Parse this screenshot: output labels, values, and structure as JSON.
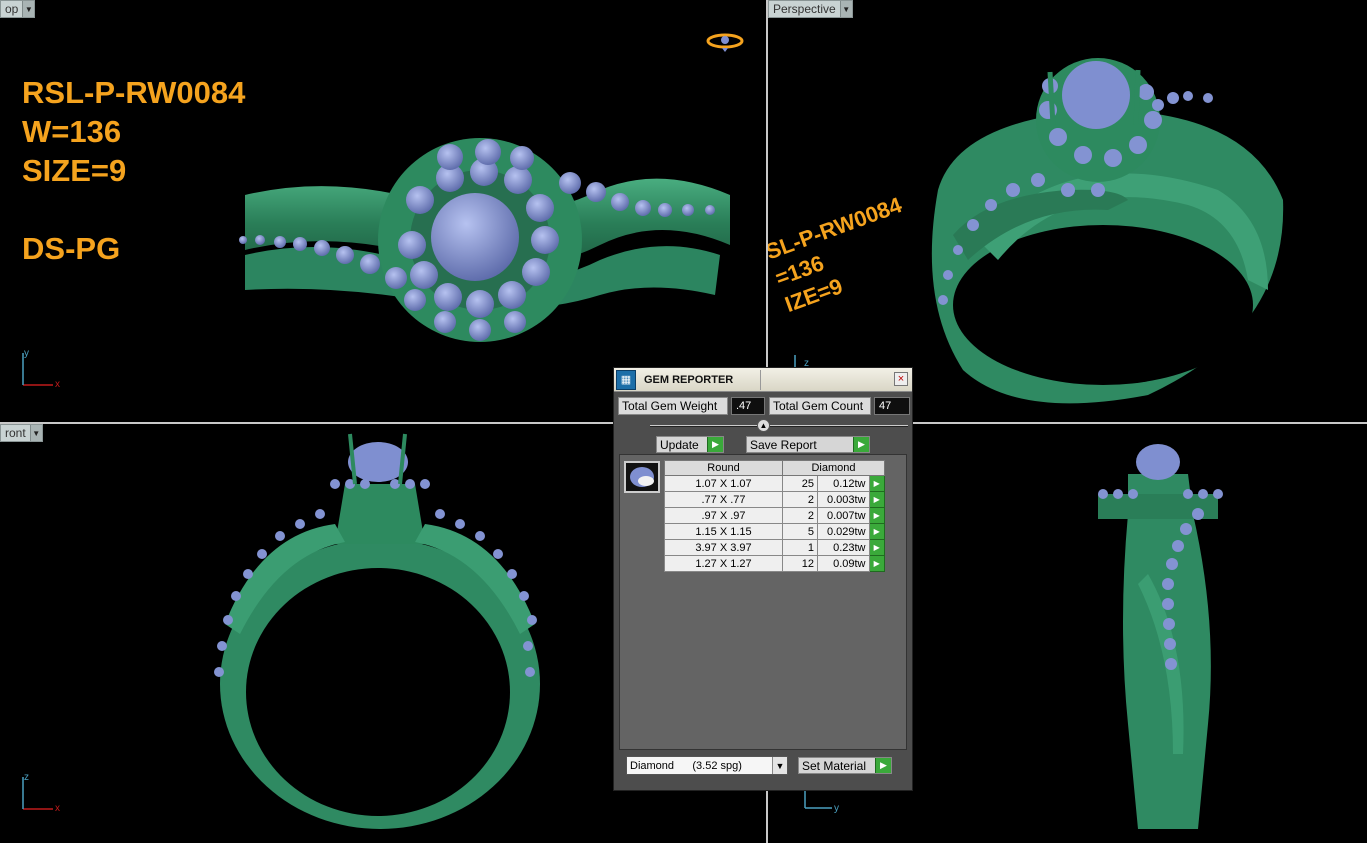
{
  "viewports": {
    "top": {
      "tab_label": "op"
    },
    "perspective": {
      "tab_label": "Perspective"
    },
    "front": {
      "tab_label": "ront"
    }
  },
  "ring_label": {
    "line1": "RSL-P-RW0084",
    "line2": "W=136",
    "line3": "SIZE=9",
    "line4": "DS-PG"
  },
  "ring_label_perspective": {
    "line1": "SL-P-RW0084",
    "line2": "=136",
    "line3": "IZE=9"
  },
  "axes": {
    "top": {
      "vertical": "y",
      "horizontal": "x"
    },
    "front": {
      "vertical": "z",
      "horizontal": "x"
    },
    "perspective": {
      "vertical": "z"
    },
    "right": {
      "horizontal": "y"
    }
  },
  "gem_reporter": {
    "title": "GEM REPORTER",
    "total_weight_label": "Total Gem Weight",
    "total_weight_value": ".47",
    "total_count_label": "Total Gem Count",
    "total_count_value": "47",
    "update_label": "Update",
    "save_report_label": "Save Report",
    "headers": {
      "shape": "Round",
      "material": "Diamond"
    },
    "rows": [
      {
        "size": "1.07 X 1.07",
        "count": "25",
        "weight": "0.12tw"
      },
      {
        "size": ".77 X .77",
        "count": "2",
        "weight": "0.003tw"
      },
      {
        "size": ".97 X .97",
        "count": "2",
        "weight": "0.007tw"
      },
      {
        "size": "1.15 X 1.15",
        "count": "5",
        "weight": "0.029tw"
      },
      {
        "size": "3.97 X 3.97",
        "count": "1",
        "weight": "0.23tw"
      },
      {
        "size": "1.27 X 1.27",
        "count": "12",
        "weight": "0.09tw"
      }
    ],
    "material_select": "Diamond      (3.52 spg)",
    "set_material_label": "Set Material"
  },
  "colors": {
    "metal": "#2f8a62",
    "gem": "#7f8fd0",
    "label": "#f5a31e",
    "accent_go": "#3aa93a"
  }
}
